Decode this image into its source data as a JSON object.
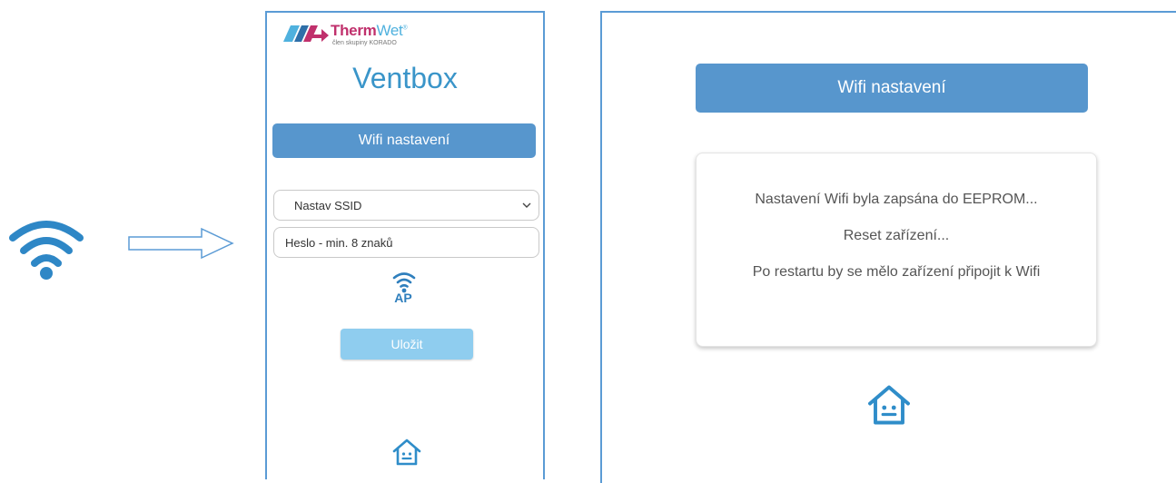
{
  "brand": {
    "name_part1": "Therm",
    "name_part2": "Wet",
    "registered": "®",
    "subtitle": "člen skupiny KORADO"
  },
  "phone": {
    "title": "Ventbox",
    "header": "Wifi nastavení",
    "ssid_select": {
      "selected": "Nastav SSID"
    },
    "password_input": {
      "placeholder": "Heslo - min. 8 znaků"
    },
    "ap_label": "AP",
    "save_label": "Uložit"
  },
  "result": {
    "header": "Wifi nastavení",
    "messages": [
      "Nastavení Wifi byla zapsána do EEPROM...",
      "Reset zařízení...",
      "Po restartu by se mělo zařízení připojit k Wifi"
    ]
  },
  "icons": {
    "wifi": "wifi-icon",
    "arrow": "arrow-right-icon",
    "ap": "wifi-ap-icon",
    "home": "home-icon"
  },
  "colors": {
    "accent_blue": "#5796cd",
    "title_blue": "#3a95c9",
    "save_button": "#8fcdef",
    "brand_magenta": "#c0306c",
    "brand_light_blue": "#4fb1de"
  }
}
